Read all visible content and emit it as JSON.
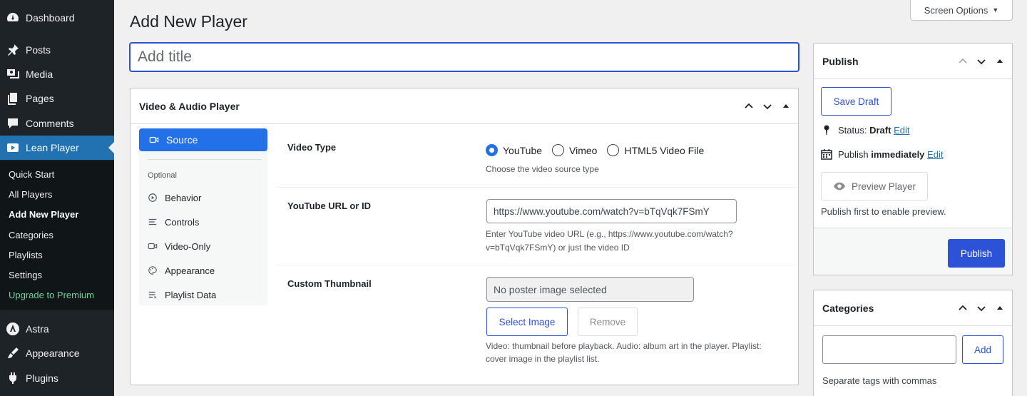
{
  "admin_menu": {
    "top_items": [
      {
        "label": "Dashboard",
        "icon": "dashboard-icon"
      },
      {
        "label": "Posts",
        "icon": "pin-icon"
      },
      {
        "label": "Media",
        "icon": "media-icon"
      },
      {
        "label": "Pages",
        "icon": "pages-icon"
      },
      {
        "label": "Comments",
        "icon": "comment-icon"
      },
      {
        "label": "Lean Player",
        "icon": "video-icon"
      }
    ],
    "submenu": [
      "Quick Start",
      "All Players",
      "Add New Player",
      "Categories",
      "Playlists",
      "Settings",
      "Upgrade to Premium"
    ],
    "bottom_items": [
      {
        "label": "Astra",
        "icon": "astra-icon"
      },
      {
        "label": "Appearance",
        "icon": "brush-icon"
      },
      {
        "label": "Plugins",
        "icon": "plugin-icon"
      }
    ]
  },
  "header": {
    "title": "Add New Player",
    "screen_options": "Screen Options"
  },
  "title_field": {
    "placeholder": "Add title"
  },
  "player_box": {
    "title": "Video & Audio Player",
    "tabs": {
      "active": "Source",
      "section_label": "Optional",
      "items": [
        "Behavior",
        "Controls",
        "Video-Only",
        "Appearance",
        "Playlist Data"
      ]
    },
    "video_type": {
      "label": "Video Type",
      "options": [
        "YouTube",
        "Vimeo",
        "HTML5 Video File"
      ],
      "selected": "YouTube",
      "help": "Choose the video source type"
    },
    "youtube": {
      "label": "YouTube URL or ID",
      "value": "https://www.youtube.com/watch?v=bTqVqk7FSmY",
      "help_line1": "Enter YouTube video URL (e.g., https://www.youtube.com/watch?",
      "help_line2": "v=bTqVqk7FSmY) or just the video ID"
    },
    "thumbnail": {
      "label": "Custom Thumbnail",
      "value": "No poster image selected",
      "select_button": "Select Image",
      "remove_button": "Remove",
      "help_line1": "Video: thumbnail before playback. Audio: album art in the player. Playlist:",
      "help_line2": "cover image in the playlist list."
    }
  },
  "publish_box": {
    "title": "Publish",
    "save_draft": "Save Draft",
    "status_label": "Status:",
    "status_value": "Draft",
    "status_edit": "Edit",
    "publish_label": "Publish",
    "publish_value": "immediately",
    "publish_edit": "Edit",
    "preview_button": "Preview Player",
    "preview_note": "Publish first to enable preview.",
    "publish_button": "Publish"
  },
  "categories_box": {
    "title": "Categories",
    "add_button": "Add",
    "help": "Separate tags with commas"
  },
  "colors": {
    "accent": "#2271e8",
    "primary_button": "#2c52d8",
    "menu_bg": "#1d2327",
    "submenu_bg": "#101517",
    "current_menu": "#2271b1",
    "premium": "#6ed39a"
  }
}
